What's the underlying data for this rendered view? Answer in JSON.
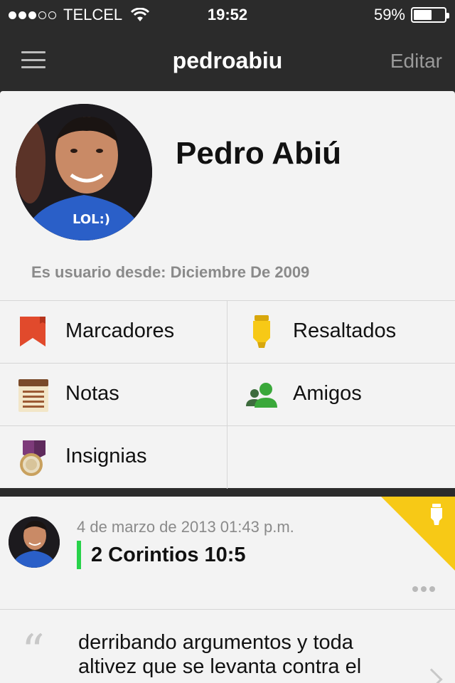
{
  "status_bar": {
    "carrier": "TELCEL",
    "signal_strength": 3,
    "time": "19:52",
    "battery_percent": "59%",
    "battery_level": 0.59
  },
  "nav": {
    "title": "pedroabiu",
    "edit_label": "Editar",
    "menu_icon": "hamburger-menu-icon"
  },
  "profile": {
    "name": "Pedro Abiú",
    "member_since": "Es usuario desde: Diciembre De 2009"
  },
  "menu_grid": [
    {
      "label": "Marcadores",
      "icon": "bookmark-icon",
      "color": "#e14a2c"
    },
    {
      "label": "Resaltados",
      "icon": "highlighter-icon",
      "color": "#f7c916"
    },
    {
      "label": "Notas",
      "icon": "notepad-icon",
      "color": "#7a4a2a"
    },
    {
      "label": "Amigos",
      "icon": "friends-icon",
      "color": "#3aa83a"
    },
    {
      "label": "Insignias",
      "icon": "medal-icon",
      "color": "#7d3a7a"
    }
  ],
  "activity": {
    "date": "4 de marzo de 2013 01:43 p.m.",
    "reference": "2 Corintios 10:5",
    "verse_text": "derribando argumentos y toda altivez que se levanta contra el",
    "type_icon": "highlighter-icon",
    "accent_color": "#28d24a",
    "corner_color": "#f7c916"
  },
  "colors": {
    "background": "#2b2b2b",
    "card": "#f3f3f3"
  }
}
